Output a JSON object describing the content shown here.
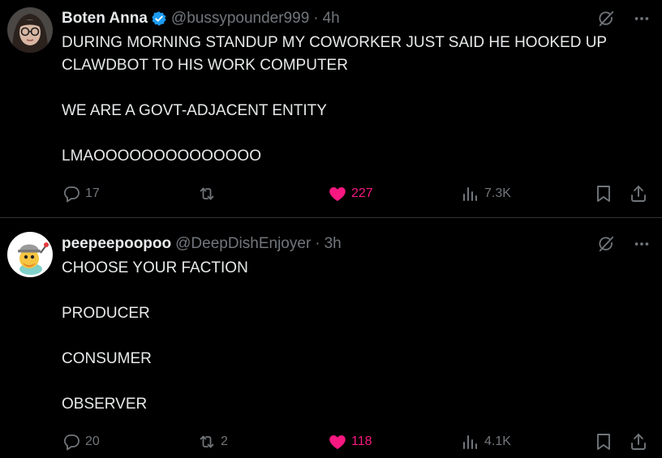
{
  "colors": {
    "background": "#000000",
    "text": "#e7e9ea",
    "muted": "#71767b",
    "like": "#f91880",
    "verified": "#1d9bf0",
    "divider": "#2f3336"
  },
  "tweets": [
    {
      "author": {
        "display_name": "Boten Anna",
        "handle": "@bussypounder999",
        "verified": true
      },
      "separator": "·",
      "time": "4h",
      "lines": [
        "DURING MORNING STANDUP MY COWORKER JUST SAID HE HOOKED UP",
        "CLAWDBOT TO HIS WORK COMPUTER",
        "",
        "WE ARE A GOVT-ADJACENT ENTITY",
        "",
        "LMAOOOOOOOOOOOOOO"
      ],
      "replies": "17",
      "retweets": "",
      "likes": "227",
      "views": "7.3K",
      "liked": true
    },
    {
      "author": {
        "display_name": "peepeepoopoo",
        "handle": "@DeepDishEnjoyer",
        "verified": false
      },
      "separator": "·",
      "time": "3h",
      "lines": [
        "CHOOSE YOUR FACTION",
        "",
        "PRODUCER",
        "",
        "CONSUMER",
        "",
        "OBSERVER"
      ],
      "replies": "20",
      "retweets": "2",
      "likes": "118",
      "views": "4.1K",
      "liked": true
    }
  ],
  "icons": {
    "grok": "grok-icon",
    "more": "more-icon",
    "reply": "reply-icon",
    "retweet": "retweet-icon",
    "like": "heart-icon",
    "views": "views-icon",
    "bookmark": "bookmark-icon",
    "share": "share-icon"
  }
}
